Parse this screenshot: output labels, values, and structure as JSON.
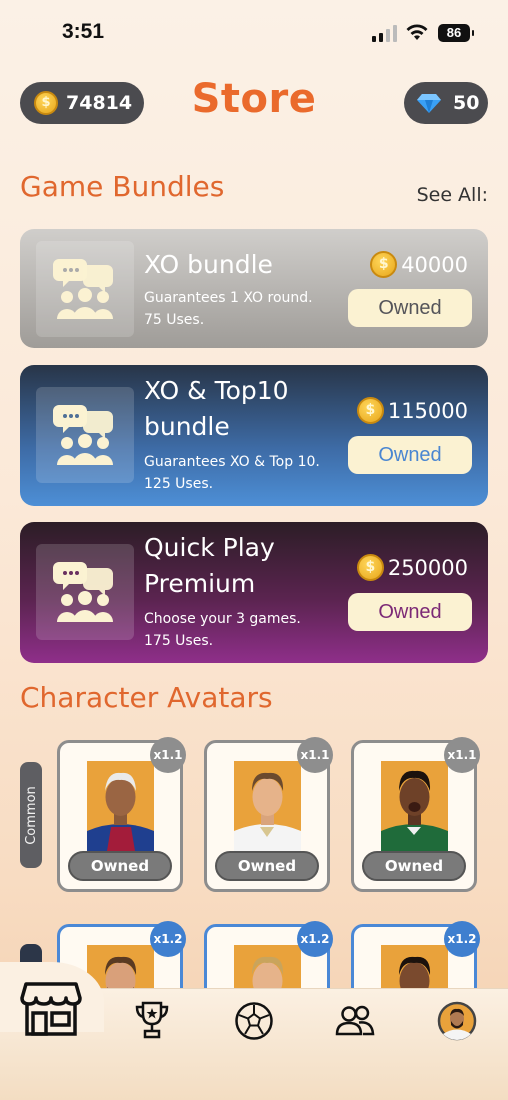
{
  "status_bar": {
    "time": "3:51",
    "battery": "86"
  },
  "header": {
    "coins": "74814",
    "gems": "50",
    "title": "Store",
    "coin_symbol": "$"
  },
  "game_bundles": {
    "title": "Game Bundles",
    "see_all": "See All:",
    "items": [
      {
        "name": "XO bundle",
        "desc_line1": "Guarantees 1 XO round.",
        "desc_line2": "75 Uses.",
        "price": "40000",
        "button": "Owned"
      },
      {
        "name": "XO & Top10 bundle",
        "desc_line1": "Guarantees XO & Top 10.",
        "desc_line2": "125 Uses.",
        "price": "115000",
        "button": "Owned"
      },
      {
        "name": "Quick Play Premium",
        "desc_line1": "Choose your 3 games.",
        "desc_line2": "175 Uses.",
        "price": "250000",
        "button": "Owned"
      }
    ]
  },
  "character_avatars": {
    "title": "Character Avatars",
    "rarity_label": "Common",
    "common": [
      {
        "multiplier": "x1.1",
        "status": "Owned"
      },
      {
        "multiplier": "x1.1",
        "status": "Owned"
      },
      {
        "multiplier": "x1.1",
        "status": "Owned"
      }
    ],
    "rare": [
      {
        "multiplier": "x1.2"
      },
      {
        "multiplier": "x1.2"
      },
      {
        "multiplier": "x1.2"
      }
    ]
  },
  "tab_bar": {
    "tabs": [
      "store-icon",
      "trophy-icon",
      "soccer-ball-icon",
      "friends-icon",
      "profile-avatar-icon"
    ]
  },
  "colors": {
    "accent": "#ea6a2c",
    "bundle_gray": "#9f9c98",
    "bundle_blue": "#4d8fd6",
    "bundle_purple": "#8f2f8a",
    "common_border": "#8d8d8d",
    "rare_border": "#4a88d6"
  }
}
